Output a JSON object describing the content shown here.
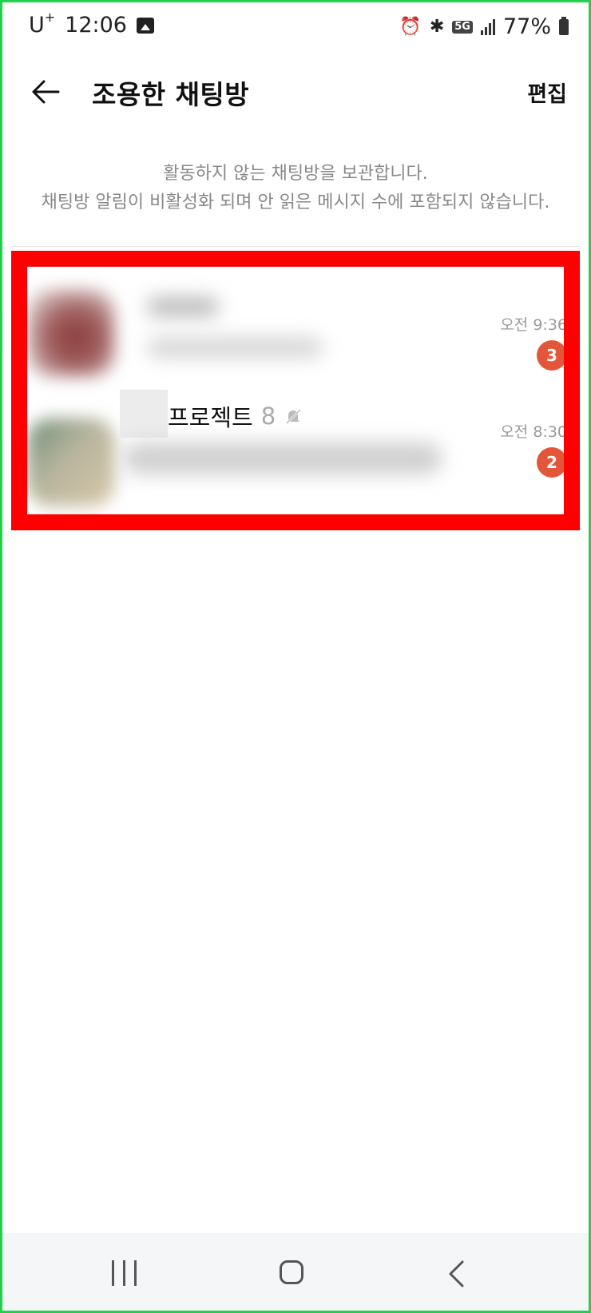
{
  "status_bar": {
    "carrier": "U",
    "carrier_sup": "+",
    "time": "12:06",
    "network": "5G",
    "battery": "77%",
    "icons": [
      "image-icon",
      "alarm-icon",
      "bluetooth-icon",
      "5g-icon",
      "signal-icon",
      "battery-icon"
    ]
  },
  "header": {
    "title": "조용한 채팅방",
    "edit_label": "편집"
  },
  "info": {
    "line1": "활동하지 않는 채팅방을 보관합니다.",
    "line2": "채팅방 알림이 비활성화 되며 안 읽은 메시지 수에 포함되지 않습니다."
  },
  "chats": [
    {
      "name": "",
      "members": "",
      "time": "오전 9:36",
      "unread": "3"
    },
    {
      "name": "프로젝트",
      "members": "8",
      "time": "오전 8:30",
      "unread": "2"
    }
  ],
  "colors": {
    "badge": "#e4563a",
    "highlight": "#ff0000",
    "frame": "#22d14b"
  }
}
